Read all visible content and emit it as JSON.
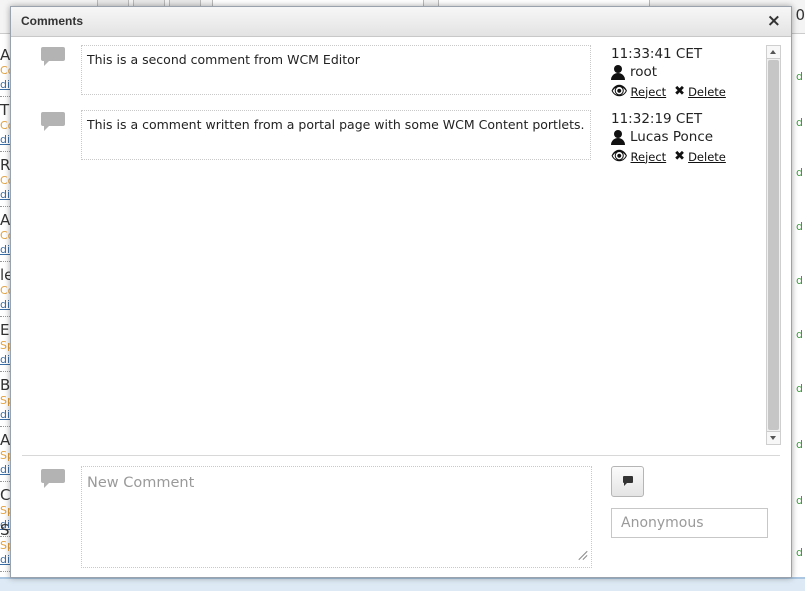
{
  "background": {
    "corner_text": "0",
    "list_items": [
      {
        "title": "Alı",
        "sub": "Co",
        "link": "di"
      },
      {
        "title": "Tic",
        "sub": "Co",
        "link": "di"
      },
      {
        "title": "Ro",
        "sub": "Co",
        "link": "di"
      },
      {
        "title": "An",
        "sub": "Co",
        "link": "di"
      },
      {
        "title": "le",
        "sub": "Co",
        "link": "di"
      },
      {
        "title": "Ex",
        "sub": "Sp",
        "link": "di"
      },
      {
        "title": "Br",
        "sub": "Sp",
        "link": "di"
      },
      {
        "title": "All",
        "sub": "Sp",
        "link": "di"
      },
      {
        "title": "Ch",
        "sub": "Sp",
        "link": "di"
      },
      {
        "title": "Sla",
        "sub": "Sp",
        "link": "di"
      }
    ],
    "right_marks": [
      "d",
      "d",
      "d",
      "d",
      "d",
      "d",
      "d",
      "d",
      "d",
      "d"
    ]
  },
  "dialog": {
    "title": "Comments",
    "close_label": "×"
  },
  "comments": [
    {
      "text": "This is a second comment from WCM Editor",
      "time": "11:33:41 CET",
      "author": "root",
      "reject_label": "Reject",
      "delete_label": "Delete"
    },
    {
      "text": "This is a comment written from a portal page with some WCM Content portlets.",
      "time": "11:32:19 CET",
      "author": "Lucas Ponce",
      "reject_label": "Reject",
      "delete_label": "Delete"
    }
  ],
  "new_comment": {
    "placeholder": "New Comment",
    "name_placeholder": "Anonymous"
  },
  "icons": {
    "comment": "comment-bubble-icon",
    "user": "user-icon",
    "reject": "eye-slash-icon",
    "delete": "x-mark-icon",
    "post": "comment-bubble-icon"
  }
}
